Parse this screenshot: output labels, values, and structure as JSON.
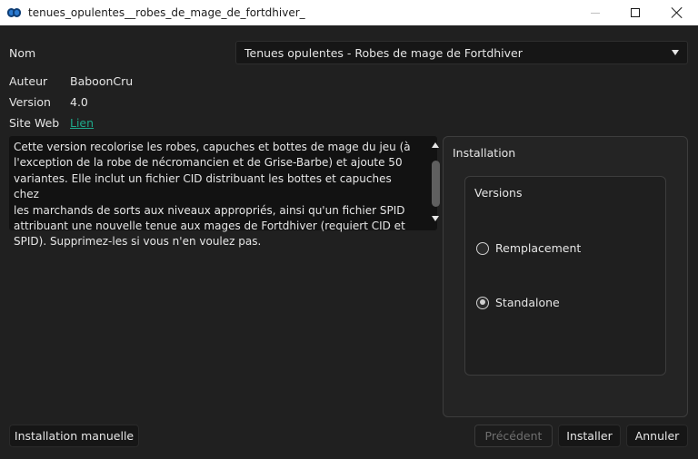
{
  "window": {
    "title": "tenues_opulentes__robes_de_mage_de_fortdhiver_"
  },
  "form": {
    "name_label": "Nom",
    "name_value": "Tenues opulentes - Robes de mage de Fortdhiver",
    "author_label": "Auteur",
    "author_value": "BaboonCru",
    "version_label": "Version",
    "version_value": "4.0",
    "website_label": "Site Web",
    "website_link": "Lien"
  },
  "description": {
    "lines": [
      "Cette version recolorise les robes, capuches et bottes de mage du jeu (à",
      "l'exception de la robe de nécromancien et de Grise-Barbe) et ajoute 50",
      "variantes. Elle inclut un fichier CID distribuant les bottes et capuches chez",
      "les marchands de sorts aux niveaux appropriés, ainsi qu'un fichier SPID",
      "attribuant une nouvelle tenue aux mages de Fortdhiver (requiert CID et",
      "SPID). Supprimez-les si vous n'en voulez pas."
    ]
  },
  "installation": {
    "group_title": "Installation",
    "versions_title": "Versions",
    "options": [
      {
        "label": "Remplacement",
        "selected": false
      },
      {
        "label": "Standalone",
        "selected": true
      }
    ]
  },
  "buttons": {
    "manual": "Installation manuelle",
    "previous": "Précédent",
    "install": "Installer",
    "cancel": "Annuler"
  },
  "colors": {
    "link": "#1ea98b",
    "background": "#202020",
    "icon_blue": "#2a7ad1"
  }
}
